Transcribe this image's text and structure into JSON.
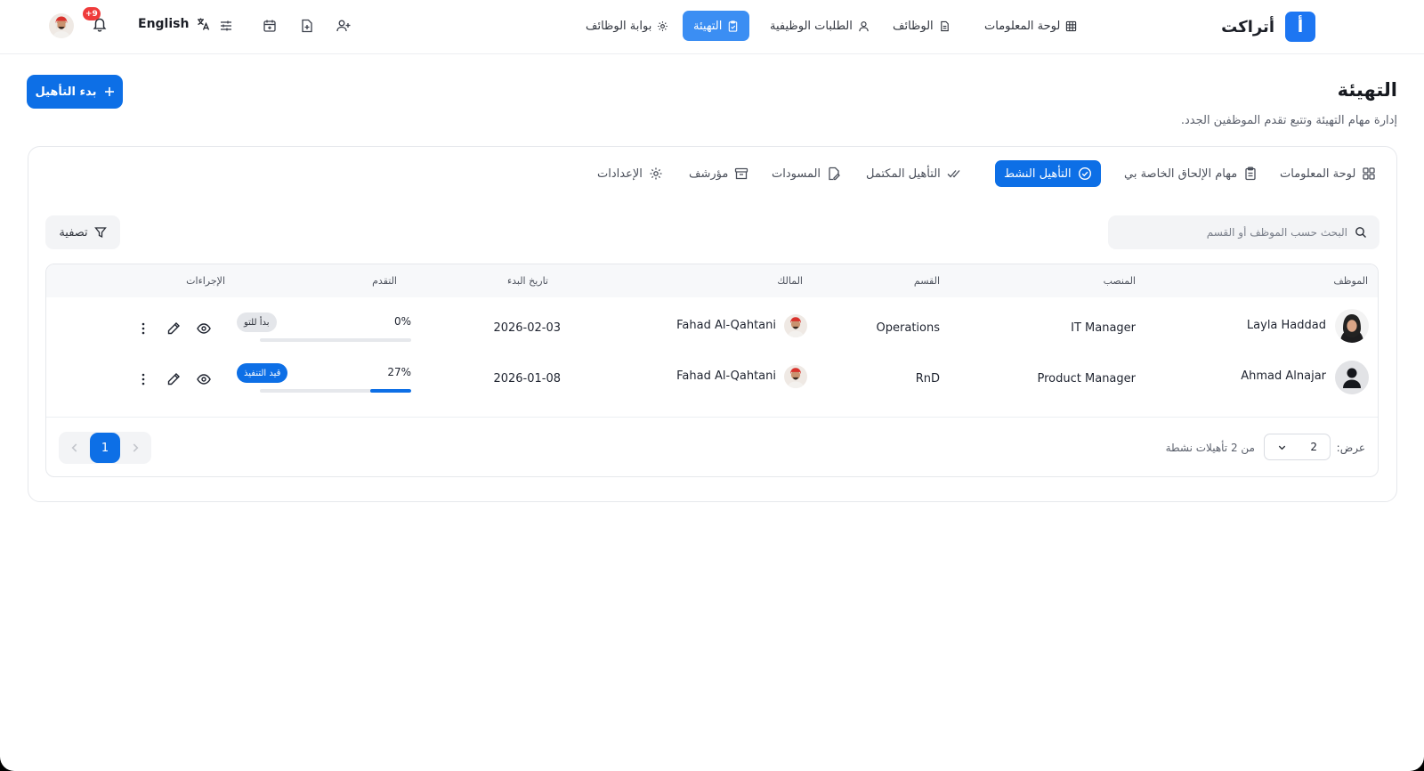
{
  "app": {
    "brand_name": "أتراكت",
    "brand_letter": "أ",
    "notifications_count": "+9",
    "language_label": "English"
  },
  "nav": {
    "items": [
      {
        "label": "لوحة المعلومات",
        "icon": "grid-icon"
      },
      {
        "label": "الوظائف",
        "icon": "file-icon"
      },
      {
        "label": "الطلبات الوظيفية",
        "icon": "user-icon"
      },
      {
        "label": "التهيئة",
        "icon": "clipboard-check-icon",
        "active": true
      },
      {
        "label": "بوابة الوظائف",
        "icon": "gear-icon"
      }
    ]
  },
  "page": {
    "title": "التهيئة",
    "subtitle": "إدارة مهام التهيئة وتتبع تقدم الموظفين الجدد.",
    "start_button": "بدء التأهيل"
  },
  "tabs": [
    {
      "label": "لوحة المعلومات",
      "icon": "dashboard-icon"
    },
    {
      "label": "مهام الإلحاق الخاصة بي",
      "icon": "clipboard-icon"
    },
    {
      "label": "التأهيل النشط",
      "icon": "check-circle-icon",
      "active": true
    },
    {
      "label": "التأهيل المكتمل",
      "icon": "double-check-icon"
    },
    {
      "label": "المسودات",
      "icon": "file-edit-icon"
    },
    {
      "label": "مؤرشف",
      "icon": "archive-icon"
    },
    {
      "label": "الإعدادات",
      "icon": "gear-icon"
    }
  ],
  "toolbar": {
    "search_placeholder": "البحث حسب الموظف أو القسم",
    "filter_label": "تصفية"
  },
  "table": {
    "headers": {
      "employee": "الموظف",
      "position": "المنصب",
      "department": "القسم",
      "owner": "المالك",
      "start_date": "تاريخ البدء",
      "progress": "التقدم",
      "actions": "الإجراءات"
    },
    "rows": [
      {
        "employee": "Layla Haddad",
        "position": "IT Manager",
        "department": "Operations",
        "owner": "Fahad Al-Qahtani",
        "start_date": "2026-02-03",
        "progress_label": "0%",
        "progress": 0,
        "status": "بدأ للتو",
        "status_color": "#e4e6ea"
      },
      {
        "employee": "Ahmad Alnajar",
        "position": "Product Manager",
        "department": "RnD",
        "owner": "Fahad Al-Qahtani",
        "start_date": "2026-01-08",
        "progress_label": "27%",
        "progress": 0.27,
        "status": "قيد التنفيذ",
        "status_color": "#0d6fe6"
      }
    ]
  },
  "footer": {
    "show_label": "عرض:",
    "page_size": "2",
    "count_label": "من 2 تأهيلات نشطة",
    "current_page": "1"
  },
  "colors": {
    "accent": "#0d6fe6",
    "nav_active": "#3b8ef3",
    "badge_notification": "#ef3b3b"
  }
}
